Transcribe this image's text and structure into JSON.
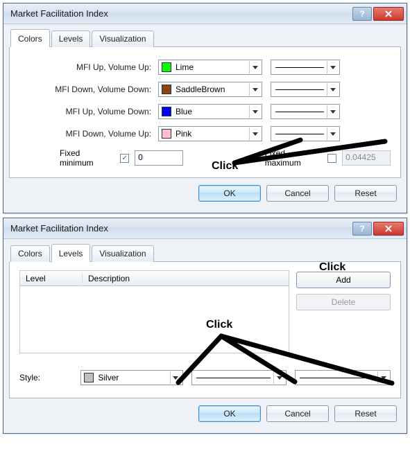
{
  "dialog1": {
    "title": "Market Facilitation Index",
    "tabs": {
      "colors": "Colors",
      "levels": "Levels",
      "visualization": "Visualization"
    },
    "active_tab": "Colors",
    "rows": [
      {
        "label": "MFI Up, Volume Up:",
        "color_name": "Lime",
        "swatch": "#00ff00"
      },
      {
        "label": "MFI Down, Volume Down:",
        "color_name": "SaddleBrown",
        "swatch": "#8b4513"
      },
      {
        "label": "MFI Up, Volume Down:",
        "color_name": "Blue",
        "swatch": "#0000ff"
      },
      {
        "label": "MFI Down, Volume Up:",
        "color_name": "Pink",
        "swatch": "#ffc0cb"
      }
    ],
    "fixed_min_label": "Fixed minimum",
    "fixed_min_checked": true,
    "fixed_min_value": "0",
    "fixed_max_label": "Fixed maximum",
    "fixed_max_checked": false,
    "fixed_max_value": "0.04425",
    "buttons": {
      "ok": "OK",
      "cancel": "Cancel",
      "reset": "Reset"
    },
    "annotation": "Click"
  },
  "dialog2": {
    "title": "Market Facilitation Index",
    "tabs": {
      "colors": "Colors",
      "levels": "Levels",
      "visualization": "Visualization"
    },
    "active_tab": "Levels",
    "table": {
      "col_level": "Level",
      "col_desc": "Description"
    },
    "side_buttons": {
      "add": "Add",
      "delete": "Delete"
    },
    "style_label": "Style:",
    "style_color_name": "Silver",
    "style_swatch": "#c0c0c0",
    "buttons": {
      "ok": "OK",
      "cancel": "Cancel",
      "reset": "Reset"
    },
    "annotation_add": "Click",
    "annotation_style": "Click"
  }
}
